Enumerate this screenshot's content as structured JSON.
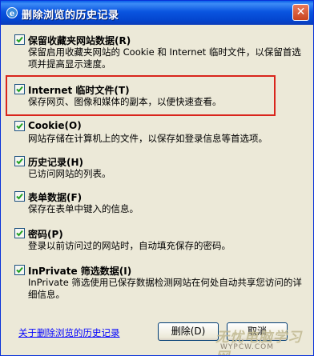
{
  "window": {
    "title": "删除浏览的历史记录",
    "close_glyph": "✕"
  },
  "options": [
    {
      "id": "favorites",
      "label": "保留收藏夹网站数据(R)",
      "desc": "保留启用收藏夹网站的 Cookie 和 Internet 临时文件，以保留首选项并提高显示速度。",
      "checked": true
    },
    {
      "id": "temp",
      "label": "Internet 临时文件(T)",
      "desc": "保存网页、图像和媒体的副本，以便快速查看。",
      "checked": true
    },
    {
      "id": "cookie",
      "label": "Cookie(O)",
      "desc": "网站存储在计算机上的文件，以保存如登录信息等首选项。",
      "checked": true
    },
    {
      "id": "history",
      "label": "历史记录(H)",
      "desc": "已访问网站的列表。",
      "checked": true
    },
    {
      "id": "form",
      "label": "表单数据(F)",
      "desc": "保存在表单中键入的信息。",
      "checked": true
    },
    {
      "id": "password",
      "label": "密码(P)",
      "desc": "登录以前访问过的网站时，自动填充保存的密码。",
      "checked": true
    },
    {
      "id": "inprivate",
      "label": "InPrivate 筛选数据(I)",
      "desc": "InPrivate 筛选使用已保存数据检测网站在何处自动共享您访问的详细信息。",
      "checked": true
    }
  ],
  "footer": {
    "about_link": "关于删除浏览的历史记录",
    "delete_label": "删除(D)",
    "cancel_label": "取消"
  },
  "watermark": {
    "line1": "无忧电脑学习网",
    "line2": "WYPCW.COM"
  },
  "colors": {
    "title_bar": "#0a55e0",
    "highlight_border": "#d9251c",
    "link": "#0000ff",
    "dialog_bg": "#ece9d8"
  }
}
